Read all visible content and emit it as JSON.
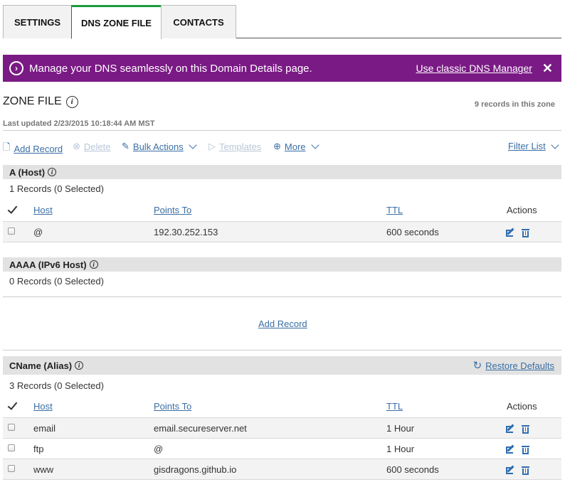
{
  "tabs": [
    {
      "label": "SETTINGS",
      "active": false
    },
    {
      "label": "DNS ZONE FILE",
      "active": true
    },
    {
      "label": "CONTACTS",
      "active": false
    }
  ],
  "banner": {
    "message": "Manage your DNS seamlessly on this Domain Details page.",
    "classic_link": "Use classic DNS Manager",
    "close": "✕",
    "color": "#7a1a85"
  },
  "zone": {
    "title": "ZONE FILE",
    "records_count": "9 records in this zone",
    "last_updated": "Last updated 2/23/2015 10:18:44 AM MST"
  },
  "toolbar": {
    "add_record": "Add Record",
    "delete": "Delete",
    "bulk_actions": "Bulk Actions",
    "templates": "Templates",
    "more": "More",
    "filter_list": "Filter List"
  },
  "columns": {
    "host": "Host",
    "points_to": "Points To",
    "ttl": "TTL",
    "actions": "Actions"
  },
  "sections": {
    "a": {
      "title": "A (Host)",
      "count": "1 Records (0 Selected)",
      "rows": [
        {
          "host": "@",
          "points_to": "192.30.252.153",
          "ttl": "600 seconds"
        }
      ]
    },
    "aaaa": {
      "title": "AAAA (IPv6 Host)",
      "count": "0 Records (0 Selected)",
      "add_record": "Add Record"
    },
    "cname": {
      "title": "CName (Alias)",
      "count": "3 Records (0 Selected)",
      "restore_defaults": "Restore Defaults",
      "rows": [
        {
          "host": "email",
          "points_to": "email.secureserver.net",
          "ttl": "1 Hour"
        },
        {
          "host": "ftp",
          "points_to": "@",
          "ttl": "1 Hour"
        },
        {
          "host": "www",
          "points_to": "gisdragons.github.io",
          "ttl": "600 seconds"
        }
      ]
    }
  },
  "accent_colors": {
    "active_tab": "#1a9c3e",
    "link": "#3a6ea5",
    "icon": "#2f6db0"
  }
}
